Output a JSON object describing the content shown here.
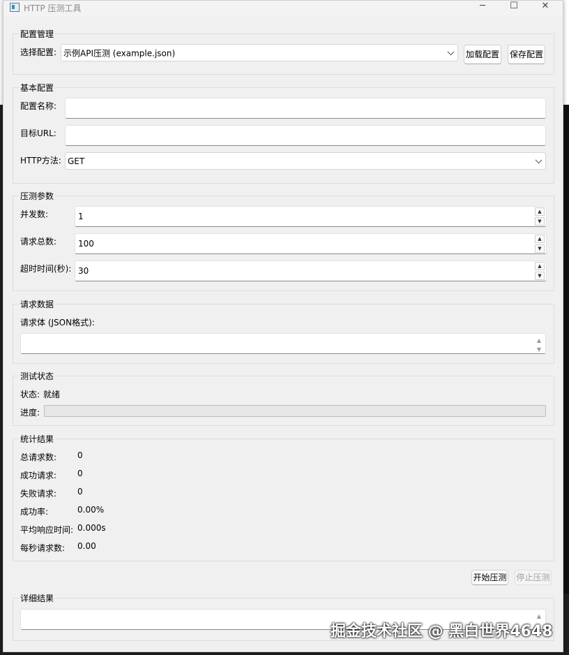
{
  "window": {
    "title": "HTTP 压测工具",
    "minimize": "─",
    "maximize": "☐",
    "close": "✕"
  },
  "config_mgmt": {
    "title": "配置管理",
    "select_label": "选择配置:",
    "selected": "示例API压测 (example.json)",
    "load_button": "加载配置",
    "save_button": "保存配置"
  },
  "basic": {
    "title": "基本配置",
    "name_label": "配置名称:",
    "name_value": "",
    "url_label": "目标URL:",
    "url_value": "",
    "method_label": "HTTP方法:",
    "method_value": "GET"
  },
  "params": {
    "title": "压测参数",
    "concurrency_label": "并发数:",
    "concurrency_value": "1",
    "total_label": "请求总数:",
    "total_value": "100",
    "timeout_label": "超时时间(秒):",
    "timeout_value": "30"
  },
  "request_data": {
    "title": "请求数据",
    "body_label": "请求体 (JSON格式):",
    "body_value": ""
  },
  "status": {
    "title": "测试状态",
    "state_label": "状态:",
    "state_value": "就绪",
    "progress_label": "进度:",
    "progress": 0
  },
  "stats": {
    "title": "统计结果",
    "rows": [
      {
        "label": "总请求数:",
        "value": "0"
      },
      {
        "label": "成功请求:",
        "value": "0"
      },
      {
        "label": "失败请求:",
        "value": "0"
      },
      {
        "label": "成功率:",
        "value": "0.00%"
      },
      {
        "label": "平均响应时间:",
        "value": "0.000s"
      },
      {
        "label": "每秒请求数:",
        "value": "0.00"
      }
    ]
  },
  "actions": {
    "start_button": "开始压测",
    "stop_button": "停止压测"
  },
  "details": {
    "title": "详细结果"
  },
  "watermark": "掘金技术社区 @ 黑白世界4648",
  "colors": {
    "window_bg": "#f0f0f0",
    "progress_fill": "#06b025"
  }
}
